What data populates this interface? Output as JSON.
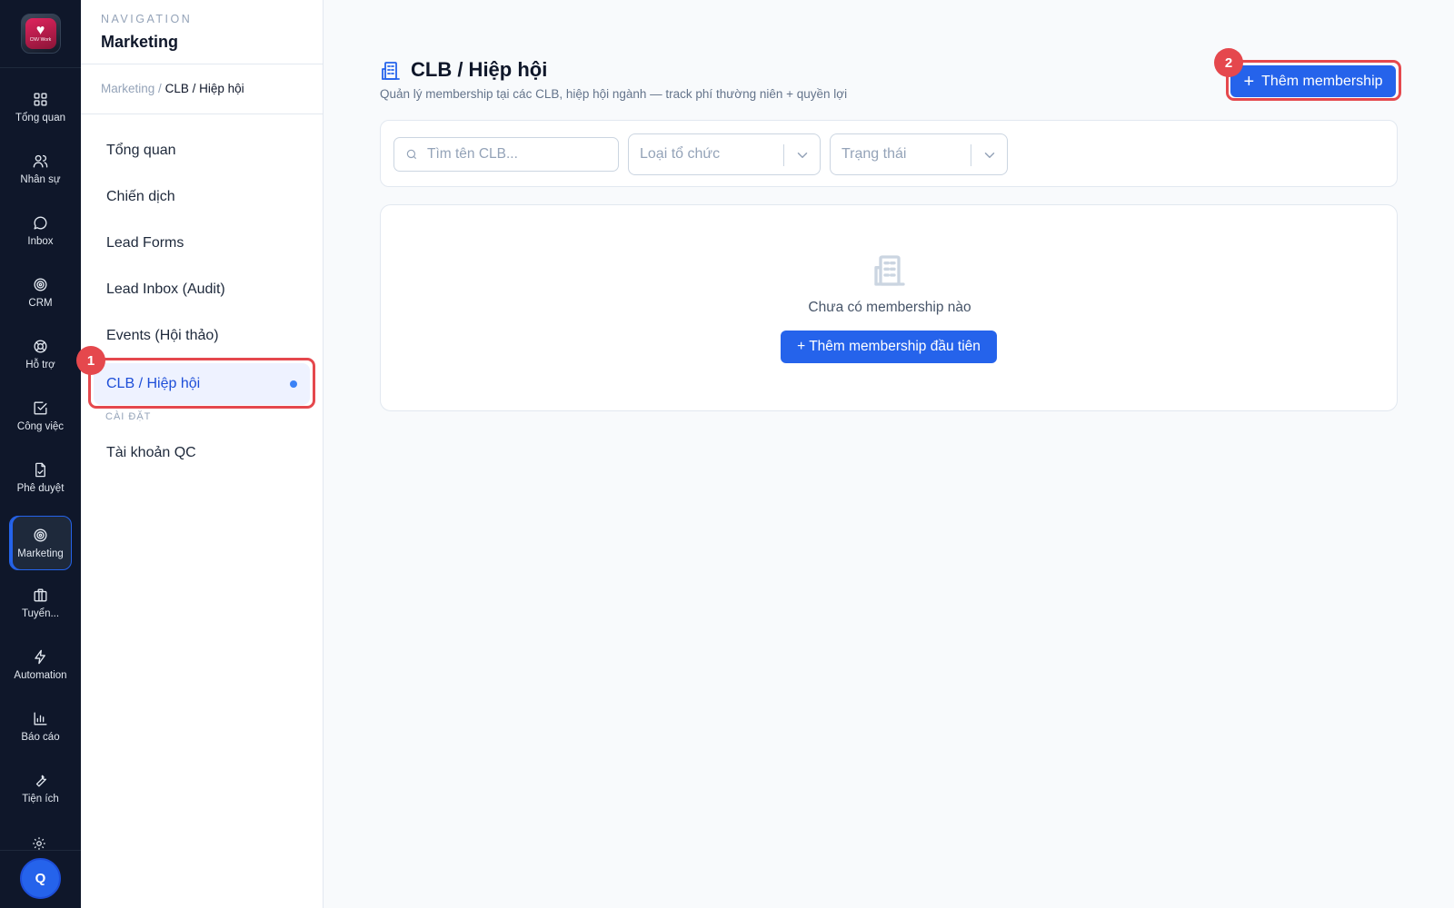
{
  "rail": {
    "logo_brand": "CNV Work",
    "items": [
      {
        "label": "Tổng quan",
        "icon": "grid-icon"
      },
      {
        "label": "Nhân sự",
        "icon": "users-icon"
      },
      {
        "label": "Inbox",
        "icon": "chat-icon"
      },
      {
        "label": "CRM",
        "icon": "target-icon"
      },
      {
        "label": "Hỗ trợ",
        "icon": "lifebuoy-icon"
      },
      {
        "label": "Công việc",
        "icon": "checkbox-icon"
      },
      {
        "label": "Phê duyệt",
        "icon": "file-sign-icon"
      },
      {
        "label": "Marketing",
        "icon": "target-icon",
        "active": true
      },
      {
        "label": "Tuyển...",
        "icon": "briefcase-icon"
      },
      {
        "label": "Automation",
        "icon": "bolt-icon"
      },
      {
        "label": "Báo cáo",
        "icon": "bar-chart-icon"
      },
      {
        "label": "Tiện ích",
        "icon": "wrench-icon"
      }
    ],
    "settings_icon": "gear-icon",
    "avatar_initial": "Q"
  },
  "nav": {
    "eyebrow": "NAVIGATION",
    "title": "Marketing",
    "breadcrumb": {
      "parent": "Marketing",
      "separator": "/",
      "current": "CLB / Hiệp hội"
    },
    "items": [
      {
        "label": "Tổng quan"
      },
      {
        "label": "Chiến dịch"
      },
      {
        "label": "Lead Forms"
      },
      {
        "label": "Lead Inbox (Audit)"
      },
      {
        "label": "Events (Hội thảo)"
      }
    ],
    "active_item": "CLB / Hiệp hội",
    "section_label": "CÀI ĐẶT",
    "settings_items": [
      {
        "label": "Tài khoản QC"
      }
    ]
  },
  "annotations": {
    "badge_1": "1",
    "badge_2": "2",
    "color": "#e5484d"
  },
  "main": {
    "title": "CLB / Hiệp hội",
    "subtitle": "Quản lý membership tại các CLB, hiệp hội ngành — track phí thường niên + quyền lợi",
    "add_button": {
      "plus": "+",
      "label": "Thêm membership"
    },
    "filters": {
      "search_placeholder": "Tìm tên CLB...",
      "type_select": "Loại tổ chức",
      "status_select": "Trạng thái"
    },
    "empty": {
      "message": "Chưa có membership nào",
      "button": "+ Thêm membership đầu tiên"
    }
  },
  "colors": {
    "accent": "#2563eb",
    "rail_bg": "#0f172a",
    "page_bg": "#f8fafc"
  }
}
